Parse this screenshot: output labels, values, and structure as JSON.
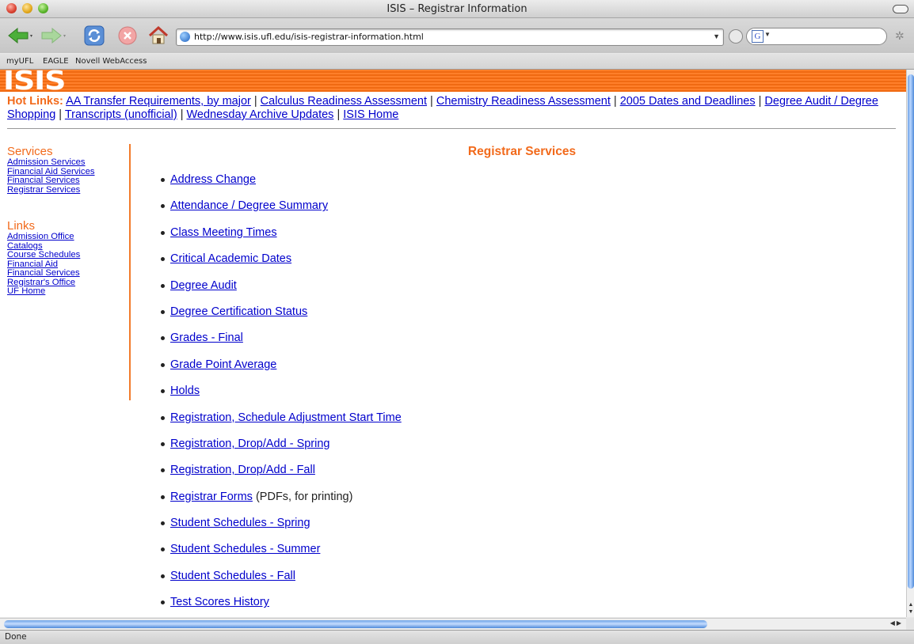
{
  "window": {
    "title": "ISIS – Registrar Information"
  },
  "toolbar": {
    "url": "http://www.isis.ufl.edu/isis-registrar-information.html",
    "search_value": ""
  },
  "bookmarks": [
    "myUFL",
    "EAGLE",
    "Novell WebAccess"
  ],
  "header": {
    "logo_text": "ISIS"
  },
  "hotlinks": {
    "label": "Hot Links:",
    "items": [
      "AA Transfer Requirements, by major",
      "Calculus Readiness Assessment",
      "Chemistry Readiness Assessment",
      "2005 Dates and Deadlines",
      "Degree Audit / Degree Shopping",
      "Transcripts (unofficial)",
      "Wednesday Archive Updates",
      "ISIS Home"
    ],
    "separator": " | "
  },
  "sidebar": {
    "services_heading": "Services",
    "services": [
      "Admission Services",
      "Financial Aid Services",
      "Financial Services",
      "Registrar Services"
    ],
    "links_heading": "Links",
    "links": [
      "Admission Office",
      "Catalogs",
      "Course Schedules",
      "Financial Aid",
      "Financial Services",
      "Registrar's Office",
      "UF Home"
    ]
  },
  "main": {
    "title": "Registrar Services",
    "items": [
      {
        "label": "Address Change",
        "suffix": ""
      },
      {
        "label": "Attendance / Degree Summary",
        "suffix": ""
      },
      {
        "label": "Class Meeting Times",
        "suffix": ""
      },
      {
        "label": "Critical Academic Dates",
        "suffix": ""
      },
      {
        "label": "Degree Audit",
        "suffix": ""
      },
      {
        "label": "Degree Certification Status",
        "suffix": ""
      },
      {
        "label": "Grades - Final",
        "suffix": ""
      },
      {
        "label": "Grade Point Average",
        "suffix": ""
      },
      {
        "label": "Holds",
        "suffix": ""
      },
      {
        "label": "Registration, Schedule Adjustment Start Time",
        "suffix": ""
      },
      {
        "label": "Registration, Drop/Add - Spring",
        "suffix": ""
      },
      {
        "label": "Registration, Drop/Add - Fall",
        "suffix": ""
      },
      {
        "label": "Registrar Forms",
        "suffix": " (PDFs, for printing)"
      },
      {
        "label": "Student Schedules - Spring",
        "suffix": ""
      },
      {
        "label": "Student Schedules - Summer",
        "suffix": ""
      },
      {
        "label": "Student Schedules - Fall",
        "suffix": ""
      },
      {
        "label": "Test Scores History",
        "suffix": ""
      }
    ]
  },
  "status": {
    "text": "Done"
  },
  "colors": {
    "accent": "#f26a1b",
    "link": "#0000cc",
    "banner": "#ff7f2a"
  },
  "icons": [
    "back-arrow-icon",
    "forward-arrow-icon",
    "reload-icon",
    "stop-icon",
    "home-icon",
    "globe-icon",
    "google-icon"
  ]
}
